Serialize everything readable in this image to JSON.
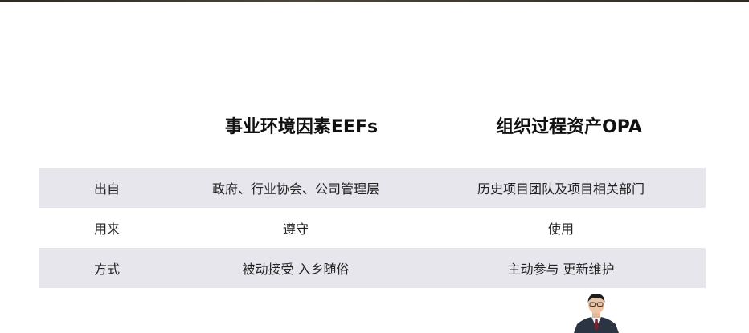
{
  "headers": {
    "eef": "事业环境因素EEFs",
    "opa": "组织过程资产OPA"
  },
  "rows": [
    {
      "label": "出自",
      "eef": "政府、行业协会、公司管理层",
      "opa": "历史项目团队及项目相关部门"
    },
    {
      "label": "用来",
      "eef": "遵守",
      "opa": "使用"
    },
    {
      "label": "方式",
      "eef": "被动接受 入乡随俗",
      "opa": "主动参与 更新维护"
    }
  ],
  "colors": {
    "row_shade": "#e7e6ec",
    "background": "#ffffff",
    "text": "#1a1a1a"
  },
  "icons": {
    "presenter": "presenter-avatar"
  }
}
